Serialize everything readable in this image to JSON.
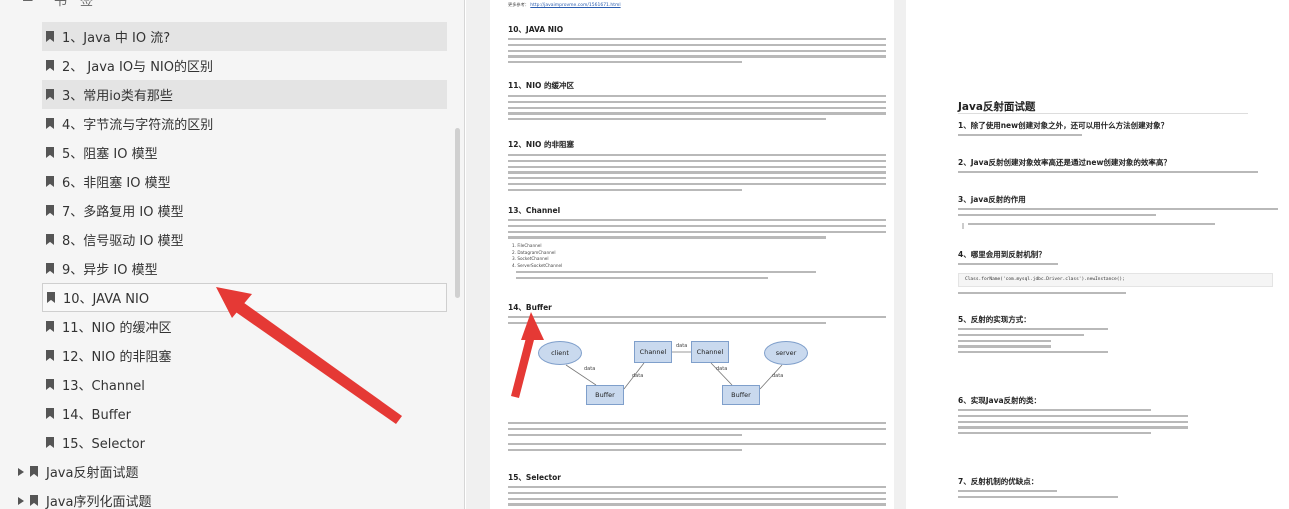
{
  "sidebar": {
    "top_labels": [
      "书",
      "签"
    ],
    "items": [
      {
        "label": "1、Java 中 IO 流?",
        "level": 2,
        "state": "selected"
      },
      {
        "label": "2、 Java IO与 NIO的区别",
        "level": 2,
        "state": "normal"
      },
      {
        "label": "3、常用io类有那些",
        "level": 2,
        "state": "selected"
      },
      {
        "label": "4、字节流与字符流的区别",
        "level": 2,
        "state": "normal"
      },
      {
        "label": "5、阻塞 IO 模型",
        "level": 2,
        "state": "normal"
      },
      {
        "label": "6、非阻塞 IO 模型",
        "level": 2,
        "state": "normal"
      },
      {
        "label": "7、多路复用 IO 模型",
        "level": 2,
        "state": "normal"
      },
      {
        "label": "8、信号驱动 IO 模型",
        "level": 2,
        "state": "normal"
      },
      {
        "label": "9、异步 IO 模型",
        "level": 2,
        "state": "normal"
      },
      {
        "label": "10、JAVA NIO",
        "level": 2,
        "state": "boxed"
      },
      {
        "label": "11、NIO 的缓冲区",
        "level": 2,
        "state": "normal"
      },
      {
        "label": "12、NIO 的非阻塞",
        "level": 2,
        "state": "normal"
      },
      {
        "label": "13、Channel",
        "level": 2,
        "state": "normal"
      },
      {
        "label": "14、Buffer",
        "level": 2,
        "state": "normal"
      },
      {
        "label": "15、Selector",
        "level": 2,
        "state": "normal"
      },
      {
        "label": "Java反射面试题",
        "level": 1,
        "state": "collapsed"
      },
      {
        "label": "Java序列化面试题",
        "level": 1,
        "state": "collapsed"
      }
    ]
  },
  "page1": {
    "ref_prefix": "更多参考：",
    "ref_link": "http://javaimprovme.com/1561671.html",
    "headings": {
      "h10": "10、JAVA NIO",
      "h11": "11、NIO 的缓冲区",
      "h12": "12、NIO 的非阻塞",
      "h13": "13、Channel",
      "h14": "14、Buffer",
      "h15": "15、Selector"
    },
    "channel_list": [
      "1. FileChannel",
      "2. DatagramChannel",
      "3. SocketChannel",
      "4. ServerSocketChannel"
    ],
    "diagram": {
      "client": "client",
      "channel1": "Channel",
      "channel2": "Channel",
      "server": "server",
      "buffer1": "Buffer",
      "buffer2": "Buffer",
      "data": "data"
    }
  },
  "page2": {
    "title": "Java反射面试题",
    "q1": "1、除了使用new创建对象之外，还可以用什么方法创建对象？",
    "q2": "2、Java反射创建对象效率高还是通过new创建对象的效率高？",
    "q3": "3、java反射的作用",
    "q4": "4、哪里会用到反射机制？",
    "code": "Class.forName('com.mysql.jdbc.Driver.class').newInstance();",
    "q5": "5、反射的实现方式：",
    "q6": "6、实现Java反射的类：",
    "q7": "7、反射机制的优缺点："
  },
  "colors": {
    "accent": "#e53935",
    "link": "#2a5db0",
    "diagram_fill": "#c9d9ee"
  }
}
